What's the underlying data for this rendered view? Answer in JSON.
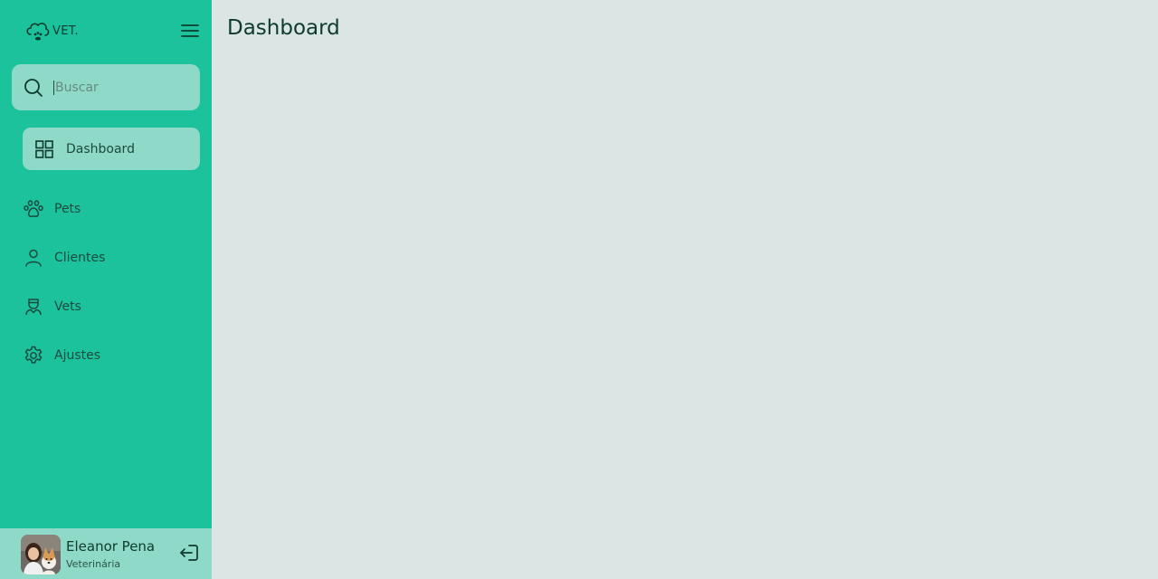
{
  "brand": {
    "text": "VET.",
    "icon": "paw-cloud-icon"
  },
  "search": {
    "placeholder": "Buscar",
    "value": ""
  },
  "sidebar": {
    "active": {
      "label": "Dashboard",
      "icon": "grid-icon"
    },
    "items": [
      {
        "label": "Pets",
        "icon": "paw-icon"
      },
      {
        "label": "Clientes",
        "icon": "user-icon"
      },
      {
        "label": "Vets",
        "icon": "vet-icon"
      },
      {
        "label": "Ajustes",
        "icon": "gear-icon"
      }
    ]
  },
  "user": {
    "name": "Eleanor Pena",
    "role": "Veterinária"
  },
  "main": {
    "title": "Dashboard"
  },
  "colors": {
    "sidebar": "#1bc29c",
    "sidebar_highlight": "#8ed9c7",
    "background": "#dbe5e3",
    "text_dark": "#0d3b2e"
  }
}
